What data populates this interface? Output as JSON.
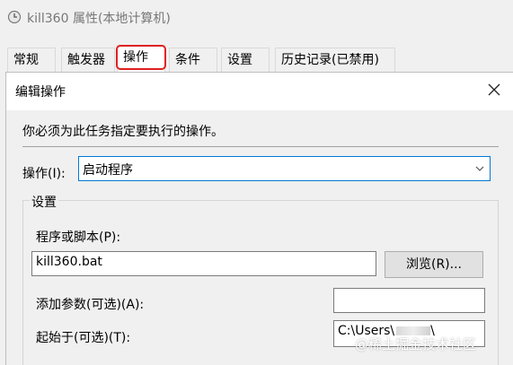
{
  "parent_window": {
    "title": "kill360 属性(本地计算机)",
    "icon": "clock-icon"
  },
  "tabs": [
    {
      "label": "常规"
    },
    {
      "label": "触发器"
    },
    {
      "label": "操作"
    },
    {
      "label": "条件"
    },
    {
      "label": "设置"
    },
    {
      "label": "历史记录(已禁用)"
    }
  ],
  "dialog": {
    "title": "编辑操作",
    "instruction": "你必须为此任务指定要执行的操作。",
    "action": {
      "label": "操作(I):",
      "value": "启动程序"
    },
    "settings": {
      "legend": "设置",
      "program_label": "程序或脚本(P):",
      "program_value": "kill360.bat",
      "browse_label": "浏览(R)...",
      "args_label": "添加参数(可选)(A):",
      "args_value": "",
      "start_label": "起始于(可选)(T):",
      "start_value_prefix": "C:\\Users\\",
      "start_value_suffix": "\\"
    }
  },
  "watermark": "@稀土掘金技术社区",
  "colors": {
    "highlight_ring": "#e02020",
    "focus_border": "#0078d7"
  }
}
